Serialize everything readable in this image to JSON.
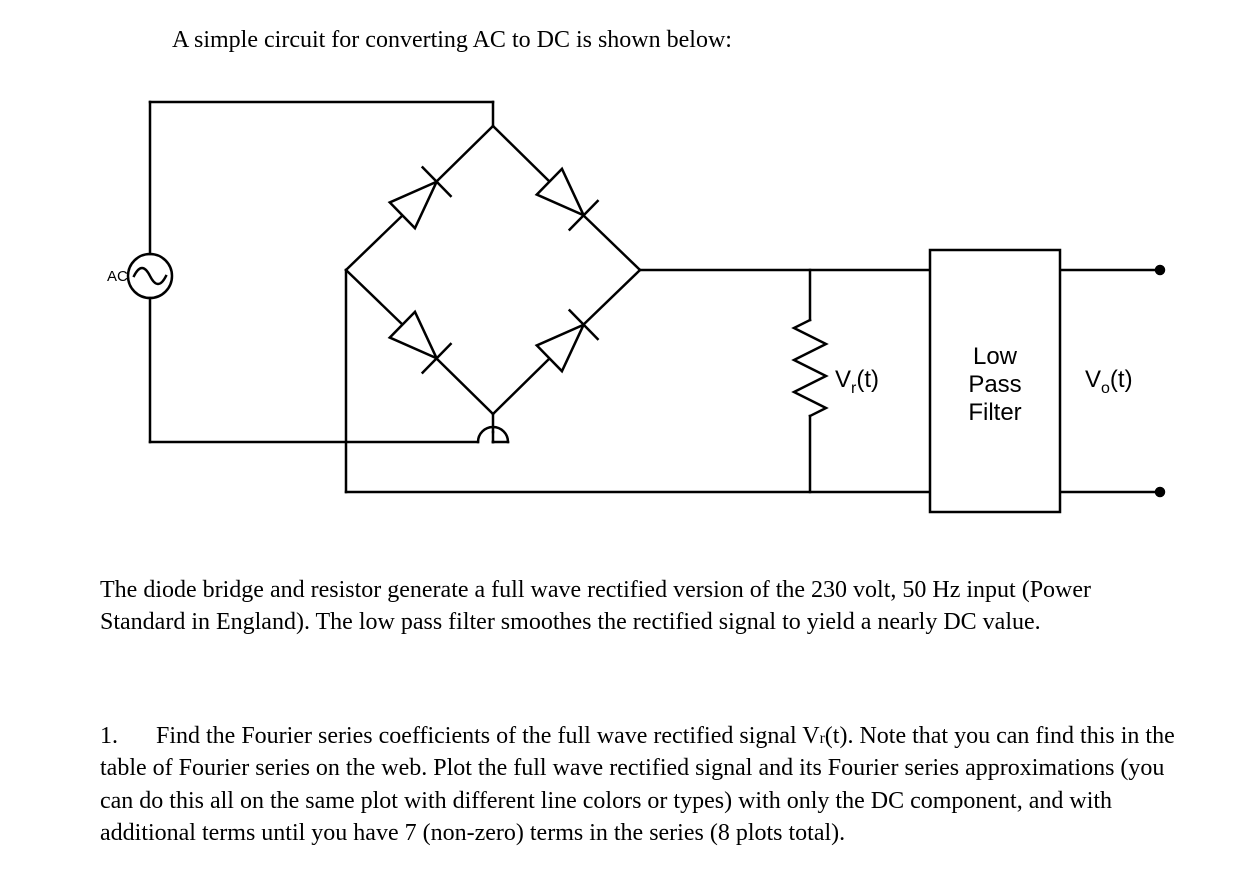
{
  "intro_text": "A simple circuit for converting AC to DC is shown below:",
  "diagram": {
    "ac_label": "AC",
    "vr_label_pre": "V",
    "vr_label_sub": "r",
    "vr_label_post": "(t)",
    "vo_label_pre": "V",
    "vo_label_sub": "o",
    "vo_label_post": "(t)",
    "filter_line1": "Low",
    "filter_line2": "Pass",
    "filter_line3": "Filter"
  },
  "para1": "The diode bridge and resistor generate a full wave rectified version of the 230 volt, 50 Hz input (Power Standard in England). The low pass filter smoothes the rectified signal to yield a nearly DC value.",
  "question1": {
    "num": "1.",
    "text_pre": "Find the Fourier series coefficients of the full wave rectified signal V",
    "text_sub": "r",
    "text_post": "(t). Note that you can find this in the table of Fourier series on the web. Plot the full wave rectified signal and its Fourier series approximations (you can do this all on the same plot with different line colors or types) with only the DC component, and with additional terms until you have 7 (non-zero) terms in the series (8 plots total)."
  }
}
